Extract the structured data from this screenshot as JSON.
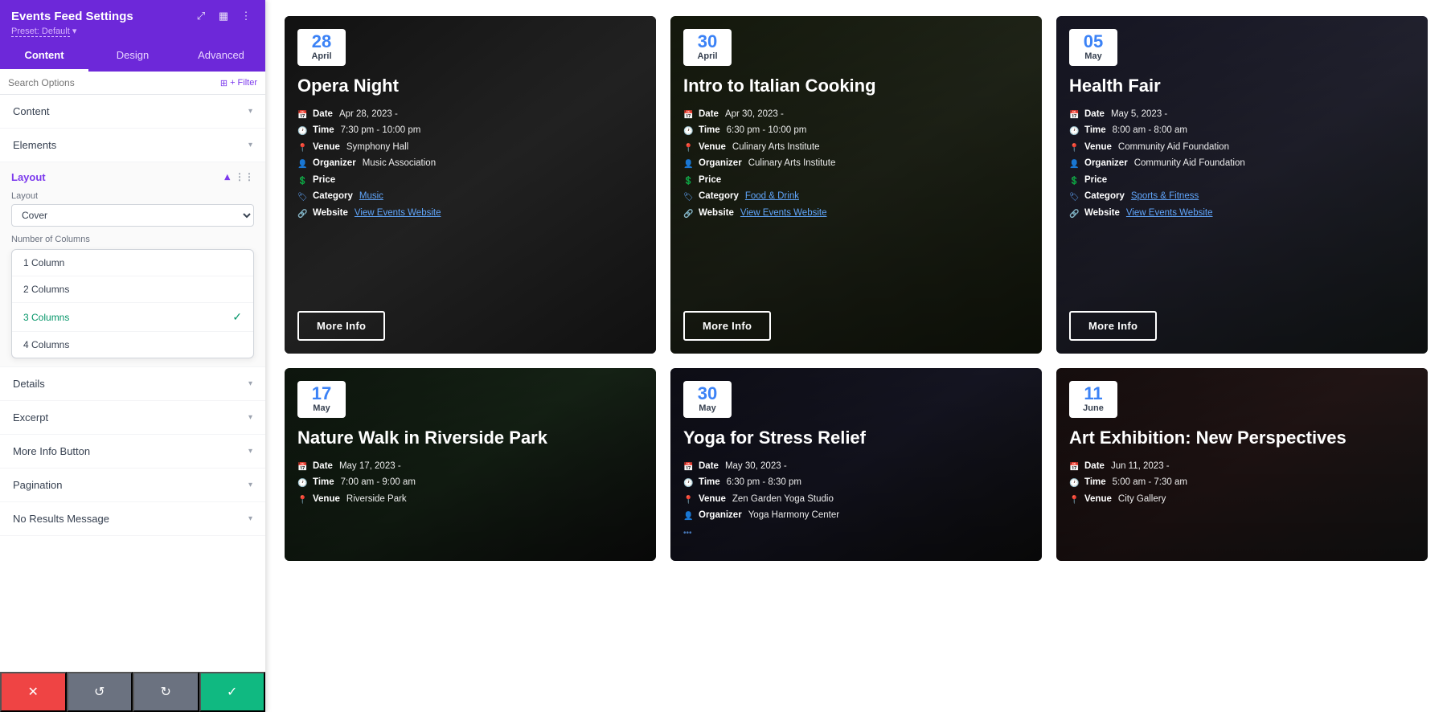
{
  "panel": {
    "title": "Events Feed Settings",
    "preset": "Preset: Default",
    "icons": [
      "resize",
      "layout",
      "more"
    ],
    "tabs": [
      "Content",
      "Design",
      "Advanced"
    ],
    "active_tab": "Content",
    "search_placeholder": "Search Options",
    "filter_label": "+ Filter",
    "sections": [
      {
        "id": "content",
        "label": "Content",
        "expanded": false
      },
      {
        "id": "elements",
        "label": "Elements",
        "expanded": false
      },
      {
        "id": "layout",
        "label": "Layout",
        "expanded": true
      },
      {
        "id": "details",
        "label": "Details",
        "expanded": false
      },
      {
        "id": "excerpt",
        "label": "Excerpt",
        "expanded": false
      },
      {
        "id": "more-info",
        "label": "More Info Button",
        "expanded": false
      },
      {
        "id": "pagination",
        "label": "Pagination",
        "expanded": false
      },
      {
        "id": "no-results",
        "label": "No Results Message",
        "expanded": false
      }
    ],
    "layout": {
      "layout_label": "Layout",
      "layout_value": "Cover",
      "columns_label": "Number of Columns",
      "columns_options": [
        {
          "label": "1 Column",
          "value": 1,
          "selected": false
        },
        {
          "label": "2 Columns",
          "value": 2,
          "selected": false
        },
        {
          "label": "3 Columns",
          "value": 3,
          "selected": true
        },
        {
          "label": "4 Columns",
          "value": 4,
          "selected": false
        }
      ]
    },
    "bottom_bar": {
      "cancel": "✕",
      "reset": "↺",
      "redo": "↻",
      "save": "✓"
    }
  },
  "events": [
    {
      "id": "opera-night",
      "day": "28",
      "month": "April",
      "title": "Opera Night",
      "bg_class": "bg-opera",
      "details": [
        {
          "icon": "📅",
          "label": "Date",
          "value": "Apr 28, 2023 -"
        },
        {
          "icon": "🕐",
          "label": "Time",
          "value": "7:30 pm - 10:00 pm"
        },
        {
          "icon": "📍",
          "label": "Venue",
          "value": "Symphony Hall"
        },
        {
          "icon": "👤",
          "label": "Organizer",
          "value": "Music Association"
        },
        {
          "icon": "💲",
          "label": "Price",
          "value": ""
        },
        {
          "icon": "🏷",
          "label": "Category",
          "value": "Music",
          "link": true
        },
        {
          "icon": "🔗",
          "label": "Website",
          "value": "View Events Website",
          "link": true
        }
      ],
      "btn_label": "More Info",
      "row": 1
    },
    {
      "id": "italian-cooking",
      "day": "30",
      "month": "April",
      "title": "Intro to Italian Cooking",
      "bg_class": "bg-cooking",
      "details": [
        {
          "icon": "📅",
          "label": "Date",
          "value": "Apr 30, 2023 -"
        },
        {
          "icon": "🕐",
          "label": "Time",
          "value": "6:30 pm - 10:00 pm"
        },
        {
          "icon": "📍",
          "label": "Venue",
          "value": "Culinary Arts Institute"
        },
        {
          "icon": "👤",
          "label": "Organizer",
          "value": "Culinary Arts Institute"
        },
        {
          "icon": "💲",
          "label": "Price",
          "value": ""
        },
        {
          "icon": "🏷",
          "label": "Category",
          "value": "Food & Drink",
          "link": true
        },
        {
          "icon": "🔗",
          "label": "Website",
          "value": "View Events Website",
          "link": true
        }
      ],
      "btn_label": "More Info",
      "row": 1
    },
    {
      "id": "health-fair",
      "day": "05",
      "month": "May",
      "title": "Health Fair",
      "bg_class": "bg-health",
      "details": [
        {
          "icon": "📅",
          "label": "Date",
          "value": "May 5, 2023 -"
        },
        {
          "icon": "🕐",
          "label": "Time",
          "value": "8:00 am - 8:00 am"
        },
        {
          "icon": "📍",
          "label": "Venue",
          "value": "Community Aid Foundation"
        },
        {
          "icon": "👤",
          "label": "Organizer",
          "value": "Community Aid Foundation"
        },
        {
          "icon": "💲",
          "label": "Price",
          "value": ""
        },
        {
          "icon": "🏷",
          "label": "Category",
          "value": "Sports & Fitness",
          "link": true
        },
        {
          "icon": "🔗",
          "label": "Website",
          "value": "View Events Website",
          "link": true
        }
      ],
      "btn_label": "More Info",
      "row": 1
    },
    {
      "id": "nature-walk",
      "day": "17",
      "month": "May",
      "title": "Nature Walk in Riverside Park",
      "bg_class": "bg-nature",
      "details": [
        {
          "icon": "📅",
          "label": "Date",
          "value": "May 17, 2023 -"
        },
        {
          "icon": "🕐",
          "label": "Time",
          "value": "7:00 am - 9:00 am"
        },
        {
          "icon": "📍",
          "label": "Venue",
          "value": "Riverside Park"
        }
      ],
      "btn_label": "More Info",
      "row": 2
    },
    {
      "id": "yoga-stress",
      "day": "30",
      "month": "May",
      "title": "Yoga for Stress Relief",
      "bg_class": "bg-yoga",
      "details": [
        {
          "icon": "📅",
          "label": "Date",
          "value": "May 30, 2023 -"
        },
        {
          "icon": "🕐",
          "label": "Time",
          "value": "6:30 pm - 8:30 pm"
        },
        {
          "icon": "📍",
          "label": "Venue",
          "value": "Zen Garden Yoga Studio"
        },
        {
          "icon": "👤",
          "label": "Organizer",
          "value": "Yoga Harmony Center"
        }
      ],
      "btn_label": "More Info",
      "row": 2
    },
    {
      "id": "art-exhibition",
      "day": "11",
      "month": "June",
      "title": "Art Exhibition: New Perspectives",
      "bg_class": "bg-art",
      "details": [
        {
          "icon": "📅",
          "label": "Date",
          "value": "Jun 11, 2023 -"
        },
        {
          "icon": "🕐",
          "label": "Time",
          "value": "5:00 am - 7:30 am"
        },
        {
          "icon": "📍",
          "label": "Venue",
          "value": "City Gallery"
        }
      ],
      "btn_label": "More Info",
      "row": 2
    }
  ]
}
